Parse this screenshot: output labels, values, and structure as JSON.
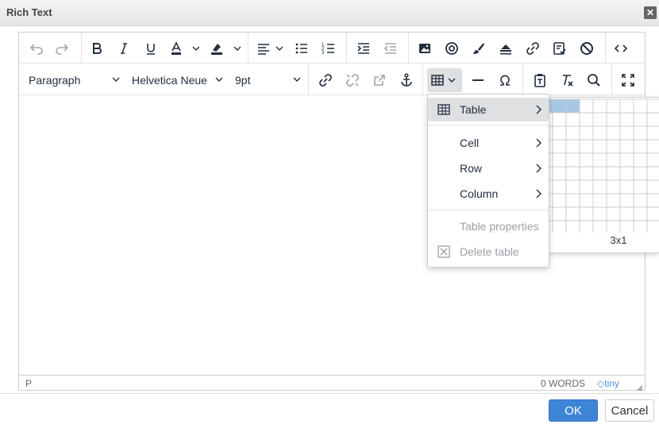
{
  "dialog": {
    "title": "Rich Text",
    "close_symbol": "✕",
    "ok_label": "OK",
    "cancel_label": "Cancel"
  },
  "toolbar": {
    "row1_icons": [
      "undo-icon",
      "redo-icon",
      "bold-icon",
      "italic-icon",
      "underline-icon",
      "text-color-icon",
      "highlight-color-icon",
      "align-icon",
      "bullet-list-icon",
      "numbered-list-icon",
      "indent-icon",
      "outdent-icon",
      "image-icon",
      "media-icon",
      "brush-icon",
      "stamp-icon",
      "link-icon",
      "template-icon",
      "cancel-icon",
      "code-icon"
    ],
    "block_format": "Paragraph",
    "font_family": "Helvetica Neue",
    "font_size": "9pt",
    "row2_icons": [
      "insert-link-icon",
      "unlink-icon",
      "open-link-icon",
      "anchor-icon",
      "table-icon",
      "horizontal-rule-icon",
      "omega-icon",
      "paste-text-icon",
      "clear-format-icon",
      "search-icon",
      "fullscreen-icon"
    ]
  },
  "status": {
    "path": "P",
    "words": "0 WORDS",
    "brand": "tiny"
  },
  "table_menu": {
    "items": [
      {
        "label": "Table",
        "has_submenu": true,
        "icon": "table-icon",
        "active": true,
        "disabled": false
      },
      {
        "label": "Cell",
        "has_submenu": true,
        "disabled": false
      },
      {
        "label": "Row",
        "has_submenu": true,
        "disabled": false
      },
      {
        "label": "Column",
        "has_submenu": true,
        "disabled": false
      },
      {
        "label": "Table properties",
        "has_submenu": false,
        "disabled": true
      },
      {
        "label": "Delete table",
        "has_submenu": false,
        "icon": "delete-table-icon",
        "disabled": true
      }
    ]
  },
  "table_grid": {
    "selection_label": "3x1",
    "selected_cols": 3,
    "selected_rows": 1,
    "highlight_color": "#a7c7e7"
  },
  "colors": {
    "accent": "#3f85d7",
    "brand_tiny": "#4f8fd0"
  }
}
